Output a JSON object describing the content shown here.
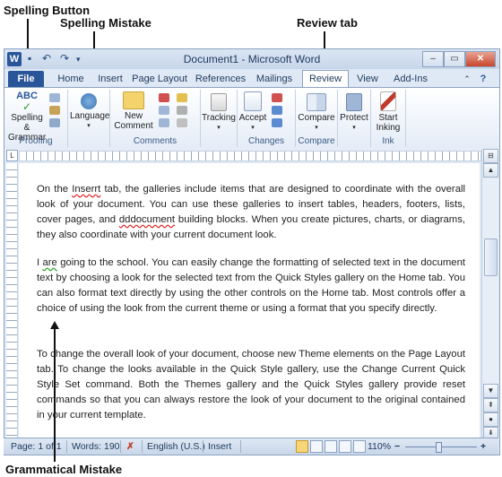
{
  "callouts": {
    "spelling_button": "Spelling Button",
    "spelling_mistake": "Spelling Mistake",
    "review_tab": "Review tab",
    "grammatical_mistake": "Grammatical Mistake"
  },
  "window": {
    "title": "Document1 - Microsoft Word",
    "app_icon": "W",
    "qat": [
      "save-icon",
      "undo-icon",
      "redo-icon",
      "customize-icon"
    ]
  },
  "tabs": [
    {
      "label": "File"
    },
    {
      "label": "Home"
    },
    {
      "label": "Insert"
    },
    {
      "label": "Page Layout"
    },
    {
      "label": "References"
    },
    {
      "label": "Mailings"
    },
    {
      "label": "Review"
    },
    {
      "label": "View"
    },
    {
      "label": "Add-Ins"
    }
  ],
  "ribbon": {
    "proofing": {
      "label": "Proofing",
      "spelling_top": "Spelling &",
      "spelling_bottom": "Grammar",
      "abc": "ABC"
    },
    "language": {
      "label": "Language"
    },
    "comments": {
      "label": "Comments",
      "new_top": "New",
      "new_bottom": "Comment"
    },
    "tracking": {
      "label": "Tracking"
    },
    "changes": {
      "label": "Changes",
      "accept": "Accept"
    },
    "compare": {
      "label": "Compare",
      "button": "Compare"
    },
    "protect": {
      "label": "Protect"
    },
    "ink": {
      "label": "Ink",
      "start_top": "Start",
      "start_bottom": "Inking"
    }
  },
  "document": {
    "p1": {
      "before": "On the ",
      "err1": "Inserrt",
      "mid": " tab, the galleries include items that are designed to coordinate with the overall look of your document. You can use these galleries to insert tables, headers, footers, lists, cover pages, and ",
      "err2": "dddocument",
      "after": " building blocks. When you create pictures, charts, or diagrams, they also coordinate with your current document look."
    },
    "p2": {
      "before": "I ",
      "err": "are",
      "after": " going to the school. You can easily change the formatting of selected text in the document text by choosing a look for the selected text from the Quick Styles gallery on the Home tab. You can also format text directly by using the other controls on the Home tab. Most controls offer a choice of using the look from the current theme or using a format that you specify directly."
    },
    "p3": "To change the overall look of your document, choose new Theme elements on the Page Layout tab. To change the looks available in the Quick Style gallery, use the Change Current Quick Style Set command. Both the Themes gallery and the Quick Styles gallery provide reset commands so that you can always restore the look of your document to the original contained in your current template."
  },
  "status": {
    "page": "Page: 1 of 1",
    "words": "Words: 190",
    "language": "English (U.S.)",
    "mode": "Insert",
    "zoom": "110%"
  },
  "colors": {
    "accent": "#2a5699",
    "spelling_error": "#e02020",
    "grammar_error": "#23a023"
  }
}
